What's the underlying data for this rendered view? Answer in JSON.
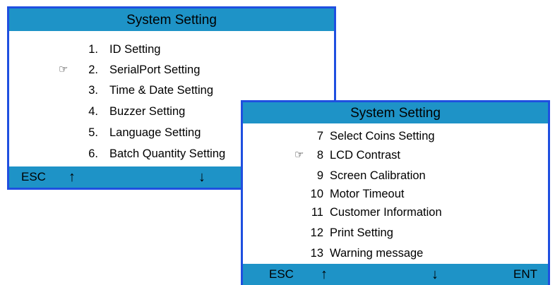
{
  "screen1": {
    "title": "System Setting",
    "items": [
      {
        "num": "1.",
        "label": "ID Setting",
        "selected": false
      },
      {
        "num": "2.",
        "label": "SerialPort Setting",
        "selected": true
      },
      {
        "num": "3.",
        "label": "Time & Date Setting",
        "selected": false
      },
      {
        "num": "4.",
        "label": "Buzzer Setting",
        "selected": false
      },
      {
        "num": "5.",
        "label": "Language Setting",
        "selected": false
      },
      {
        "num": "6.",
        "label": "Batch Quantity Setting",
        "selected": false
      }
    ],
    "footer": {
      "esc": "ESC",
      "up": "↑",
      "down": "↓"
    }
  },
  "screen2": {
    "title": "System Setting",
    "items": [
      {
        "num": "7",
        "label": "Select Coins Setting",
        "selected": false
      },
      {
        "num": "8",
        "label": "LCD Contrast",
        "selected": true
      },
      {
        "num": "9",
        "label": "Screen Calibration",
        "selected": false
      },
      {
        "num": "10",
        "label": "Motor Timeout",
        "selected": false
      },
      {
        "num": "11",
        "label": "Customer Information",
        "selected": false
      },
      {
        "num": "12",
        "label": "Print Setting",
        "selected": false
      },
      {
        "num": "13",
        "label": "Warning message",
        "selected": false
      }
    ],
    "footer": {
      "esc": "ESC",
      "up": "↑",
      "down": "↓",
      "ent": "ENT"
    }
  },
  "pointer_glyph": "☞",
  "colors": {
    "bar": "#1e93c7",
    "border": "#1f4fe0",
    "background": "#ffffff"
  }
}
